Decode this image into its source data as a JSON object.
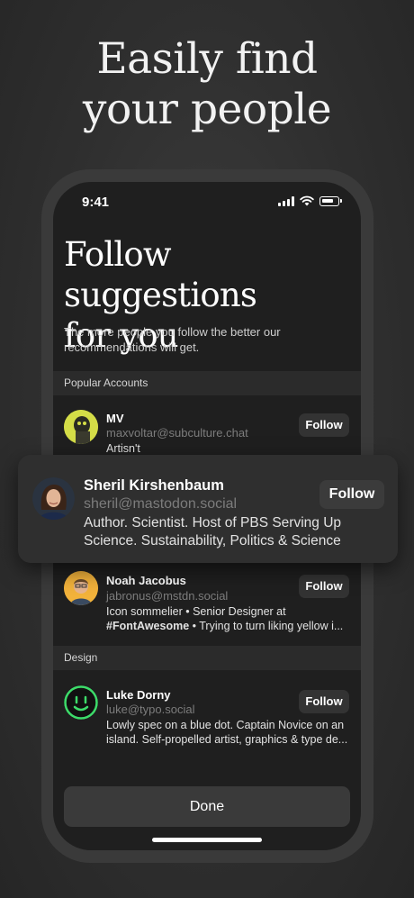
{
  "hero": {
    "line1": "Easily find",
    "line2": "your people"
  },
  "status": {
    "time": "9:41"
  },
  "page": {
    "title_line1": "Follow suggestions",
    "title_line2": "for you",
    "subtitle": "The more people you follow the better our recommendations will get."
  },
  "sections": {
    "popular": "Popular Accounts",
    "design": "Design"
  },
  "accounts": [
    {
      "name": "MV",
      "handle": "maxvoltar@subculture.chat",
      "bio": "Artisn't",
      "follow": "Follow"
    },
    {
      "name": "Sheril Kirshenbaum",
      "handle": "sheril@mastodon.social",
      "bio": "Author. Scientist. Host of PBS Serving Up Science. Sustainability, Politics & Science",
      "follow": "Follow"
    },
    {
      "name": "Noah Jacobus",
      "handle": "jabronus@mstdn.social",
      "bio_pre": "Icon sommelier • Senior Designer at ",
      "bio_bold": "#FontAwesome",
      "bio_post": " • Trying to turn liking yellow i...",
      "follow": "Follow"
    },
    {
      "name": "Luke Dorny",
      "handle": "luke@typo.social",
      "bio": "Lowly spec on a blue dot. Captain Novice on an island. Self-propelled artist, graphics & type de...",
      "follow": "Follow"
    }
  ],
  "done": "Done",
  "colors": {
    "background": "#2f2f2f",
    "screen": "#1f1f1f",
    "button": "#333333",
    "section": "#2b2b2b"
  }
}
